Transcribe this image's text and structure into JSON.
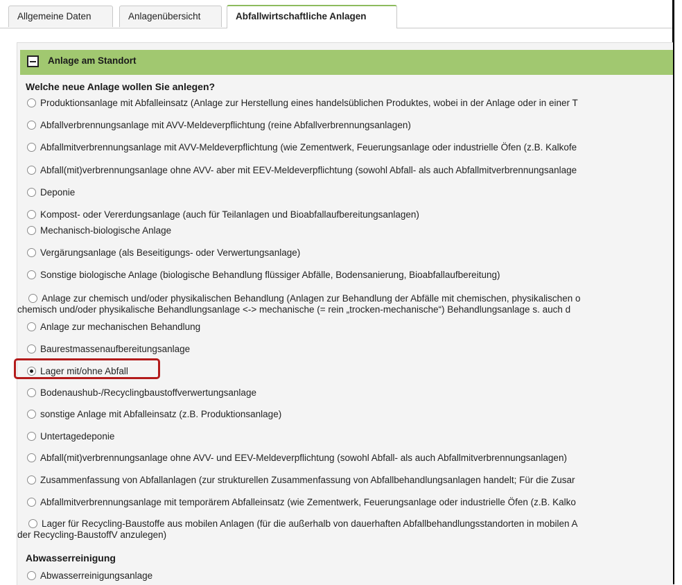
{
  "tabs": [
    {
      "label": "Allgemeine Daten"
    },
    {
      "label": "Anlagenübersicht"
    },
    {
      "label": "Abfallwirtschaftliche Anlagen"
    }
  ],
  "panel": {
    "title": "Anlage am Standort",
    "question": "Welche neue Anlage wollen Sie anlegen?",
    "options": [
      {
        "label": "Produktionsanlage mit Abfalleinsatz (Anlage zur Herstellung eines handelsüblichen Produktes, wobei in der Anlage oder in einer T",
        "selected": false
      },
      {
        "label": "Abfallverbrennungsanlage mit AVV-Meldeverpflichtung (reine Abfallverbrennungsanlagen)",
        "selected": false
      },
      {
        "label": "Abfallmitverbrennungsanlage mit AVV-Meldeverpflichtung (wie Zementwerk, Feuerungsanlage oder industrielle Öfen (z.B. Kalkofe",
        "selected": false
      },
      {
        "label": "Abfall(mit)verbrennungsanlage ohne AVV- aber mit EEV-Meldeverpflichtung (sowohl Abfall- als auch Abfallmitverbrennungsanlage",
        "selected": false
      },
      {
        "label": "Deponie",
        "selected": false
      },
      {
        "label": "Kompost- oder Vererdungsanlage (auch für Teilanlagen und Bioabfallaufbereitungsanlagen)",
        "selected": false
      },
      {
        "label": "Mechanisch-biologische Anlage",
        "selected": false
      },
      {
        "label": "Vergärungsanlage (als Beseitigungs- oder Verwertungsanlage)",
        "selected": false
      },
      {
        "label": "Sonstige biologische Anlage (biologische Behandlung flüssiger Abfälle, Bodensanierung, Bioabfallaufbereitung)",
        "selected": false
      },
      {
        "label": "Anlage zur chemisch und/oder physikalischen Behandlung (Anlagen zur Behandlung der Abfälle mit chemischen, physikalischen o",
        "label2": "chemisch und/oder physikalische Behandlungsanlage <-> mechanische (= rein „trocken-mechanische“) Behandlungsanlage s. auch d",
        "selected": false
      },
      {
        "label": "Anlage zur mechanischen Behandlung",
        "selected": false
      },
      {
        "label": "Baurestmassenaufbereitungsanlage",
        "selected": false
      },
      {
        "label": "Lager mit/ohne Abfall",
        "selected": true
      },
      {
        "label": "Bodenaushub-/Recyclingbaustoffverwertungsanlage",
        "selected": false
      },
      {
        "label": "sonstige Anlage mit Abfalleinsatz (z.B. Produktionsanlage)",
        "selected": false
      },
      {
        "label": "Untertagedeponie",
        "selected": false
      },
      {
        "label": "Abfall(mit)verbrennungsanlage ohne AVV- und EEV-Meldeverpflichtung (sowohl Abfall- als auch Abfallmitverbrennungsanlagen)",
        "selected": false
      },
      {
        "label": "Zusammenfassung von Abfallanlagen (zur strukturellen Zusammenfassung von Abfallbehandlungsanlagen handelt; Für die Zusar",
        "selected": false
      },
      {
        "label": "Abfallmitverbrennungsanlage mit temporärem Abfalleinsatz (wie Zementwerk, Feuerungsanlage oder industrielle Öfen (z.B. Kalko",
        "selected": false
      },
      {
        "label": "Lager für Recycling-Baustoffe aus mobilen Anlagen (für die außerhalb von dauerhaften Abfallbehandlungsstandorten in mobilen A",
        "label2": "der Recycling-BaustoffV anzulegen)",
        "selected": false
      }
    ],
    "section2_title": "Abwasserreinigung",
    "section2_options": [
      {
        "label": "Abwasserreinigungsanlage",
        "selected": false
      }
    ]
  }
}
